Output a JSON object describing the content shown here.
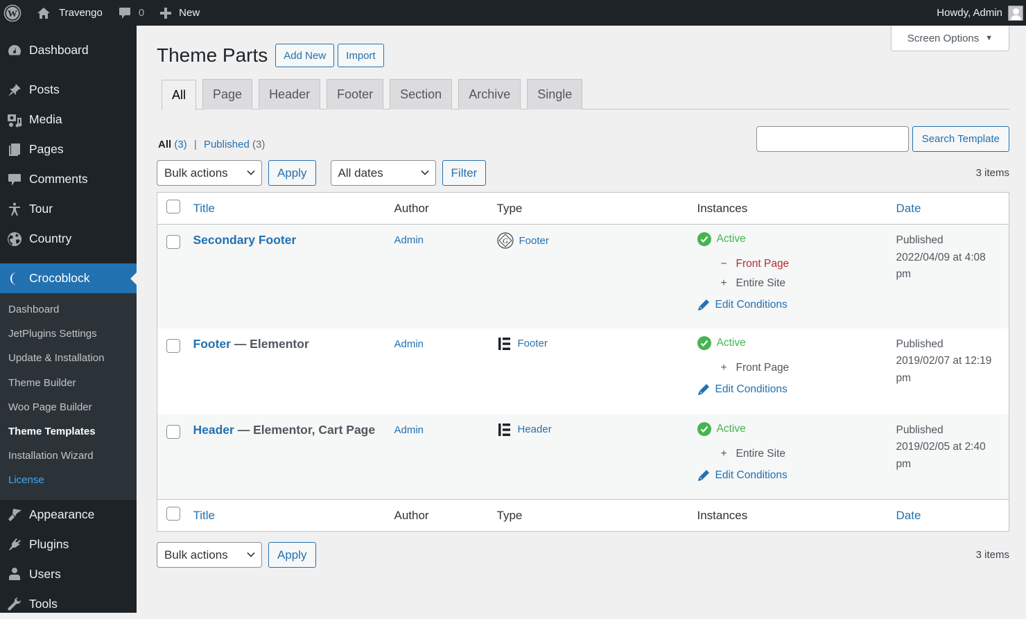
{
  "admin_bar": {
    "site_name": "Travengo",
    "comments_count": "0",
    "new_label": "New",
    "greeting": "Howdy, Admin"
  },
  "sidebar": {
    "items_top": [
      {
        "label": "Dashboard",
        "icon": "dashboard-icon"
      },
      {
        "label": "Posts",
        "icon": "pin-icon"
      },
      {
        "label": "Media",
        "icon": "media-icon"
      },
      {
        "label": "Pages",
        "icon": "pages-icon"
      },
      {
        "label": "Comments",
        "icon": "comment-icon"
      },
      {
        "label": "Tour",
        "icon": "person-icon"
      },
      {
        "label": "Country",
        "icon": "globe-icon"
      }
    ],
    "current": {
      "label": "Crocoblock",
      "icon": "crocoblock-icon"
    },
    "submenu": [
      {
        "label": "Dashboard"
      },
      {
        "label": "JetPlugins Settings"
      },
      {
        "label": "Update & Installation"
      },
      {
        "label": "Theme Builder"
      },
      {
        "label": "Woo Page Builder"
      },
      {
        "label": "Theme Templates"
      },
      {
        "label": "Installation Wizard"
      },
      {
        "label": "License"
      }
    ],
    "items_bottom": [
      {
        "label": "Appearance",
        "icon": "brush-icon"
      },
      {
        "label": "Plugins",
        "icon": "plug-icon"
      },
      {
        "label": "Users",
        "icon": "user-icon"
      },
      {
        "label": "Tools",
        "icon": "wrench-icon"
      }
    ]
  },
  "page": {
    "screen_options": "Screen Options",
    "title": "Theme Parts",
    "add_new": "Add New",
    "import": "Import",
    "tabs": [
      "All",
      "Page",
      "Header",
      "Footer",
      "Section",
      "Archive",
      "Single"
    ],
    "active_tab": "All",
    "views": {
      "all_label": "All",
      "all_count": "(3)",
      "separator": "|",
      "published_label": "Published",
      "published_count": "(3)"
    },
    "search": {
      "value": "",
      "button": "Search Template"
    },
    "bulk_actions": "Bulk actions",
    "apply": "Apply",
    "dates": "All dates",
    "filter": "Filter",
    "items_count": "3 items"
  },
  "table": {
    "columns": {
      "title": "Title",
      "author": "Author",
      "type": "Type",
      "instances": "Instances",
      "date": "Date"
    },
    "rows": [
      {
        "title": "Secondary Footer",
        "title_suffix": "",
        "author": "Admin",
        "type_icon": "gutenberg-icon",
        "type": "Footer",
        "status": "Active",
        "conditions": [
          {
            "symbol": "−",
            "label": "Front Page",
            "kind": "exclude"
          },
          {
            "symbol": "+",
            "label": "Entire Site",
            "kind": "include"
          }
        ],
        "edit_label": "Edit Conditions",
        "date_status": "Published",
        "date": "2022/04/09 at 4:08",
        "date_tail": "pm"
      },
      {
        "title": "Footer",
        "title_suffix": " — Elementor",
        "author": "Admin",
        "type_icon": "elementor-icon",
        "type": "Footer",
        "status": "Active",
        "conditions": [
          {
            "symbol": "+",
            "label": "Front Page",
            "kind": "include"
          }
        ],
        "edit_label": "Edit Conditions",
        "date_status": "Published",
        "date": "2019/02/07 at 12:19",
        "date_tail": "pm"
      },
      {
        "title": "Header",
        "title_suffix": " — Elementor, Cart Page",
        "author": "Admin",
        "type_icon": "elementor-icon",
        "type": "Header",
        "status": "Active",
        "conditions": [
          {
            "symbol": "+",
            "label": "Entire Site",
            "kind": "include"
          }
        ],
        "edit_label": "Edit Conditions",
        "date_status": "Published",
        "date": "2019/02/05 at 2:40",
        "date_tail": "pm"
      }
    ]
  }
}
